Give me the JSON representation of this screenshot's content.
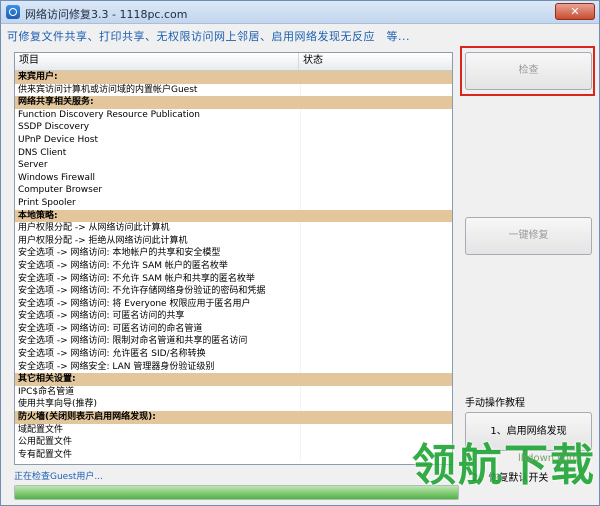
{
  "window": {
    "title": "网络访问修复3.3 - 1118pc.com",
    "close_label": "✕"
  },
  "subtitle": "可修复文件共享、打印共享、无权限访问网上邻居、启用网络发现无反应　等...",
  "list": {
    "columns": {
      "item": "项目",
      "status": "状态"
    },
    "rows": [
      {
        "text": "来宾用户:",
        "section": true
      },
      {
        "text": "供来宾访问计算机或访问域的内置帐户Guest",
        "section": false
      },
      {
        "text": "网络共享相关服务:",
        "section": true
      },
      {
        "text": "Function Discovery Resource Publication",
        "section": false
      },
      {
        "text": "SSDP Discovery",
        "section": false
      },
      {
        "text": "UPnP Device Host",
        "section": false
      },
      {
        "text": "DNS Client",
        "section": false
      },
      {
        "text": "Server",
        "section": false
      },
      {
        "text": "Windows Firewall",
        "section": false
      },
      {
        "text": "Computer Browser",
        "section": false
      },
      {
        "text": "Print Spooler",
        "section": false
      },
      {
        "text": "本地策略:",
        "section": true
      },
      {
        "text": "用户权限分配 -> 从网络访问此计算机",
        "section": false
      },
      {
        "text": "用户权限分配 -> 拒绝从网络访问此计算机",
        "section": false
      },
      {
        "text": "安全选项 -> 网络访问: 本地帐户的共享和安全模型",
        "section": false
      },
      {
        "text": "安全选项 -> 网络访问: 不允许 SAM 帐户的匿名枚举",
        "section": false
      },
      {
        "text": "安全选项 -> 网络访问: 不允许 SAM 帐户和共享的匿名枚举",
        "section": false
      },
      {
        "text": "安全选项 -> 网络访问: 不允许存储网络身份验证的密码和凭据",
        "section": false
      },
      {
        "text": "安全选项 -> 网络访问: 将 Everyone 权限应用于匿名用户",
        "section": false
      },
      {
        "text": "安全选项 -> 网络访问: 可匿名访问的共享",
        "section": false
      },
      {
        "text": "安全选项 -> 网络访问: 可匿名访问的命名管道",
        "section": false
      },
      {
        "text": "安全选项 -> 网络访问: 限制对命名管道和共享的匿名访问",
        "section": false
      },
      {
        "text": "安全选项 -> 网络访问: 允许匿名 SID/名称转换",
        "section": false
      },
      {
        "text": "安全选项 -> 网络安全: LAN 管理器身份验证级别",
        "section": false
      },
      {
        "text": "其它相关设置:",
        "section": true
      },
      {
        "text": "IPC$命名管道",
        "section": false
      },
      {
        "text": "使用共享向导(推荐)",
        "section": false
      },
      {
        "text": "防火墙(关闭则表示启用网络发现):",
        "section": true
      },
      {
        "text": "域配置文件",
        "section": false
      },
      {
        "text": "公用配置文件",
        "section": false
      },
      {
        "text": "专有配置文件",
        "section": false
      }
    ]
  },
  "buttons": {
    "check": "检查",
    "one_key_repair": "一键修复",
    "enable_network_discovery": "1、启用网络发现"
  },
  "manual_label": "手动操作教程",
  "restore_label": "2、恢复默认开关",
  "status_text": "正在检查Guest用户...",
  "progress": {
    "fraction": 1.0
  },
  "watermark": {
    "text": "领航下载",
    "url": "lhdown.com"
  },
  "colors": {
    "accent": "#1a5fb4",
    "section_bg": "#e3c69c",
    "highlight": "#d9261c",
    "watermark": "#23a638"
  }
}
